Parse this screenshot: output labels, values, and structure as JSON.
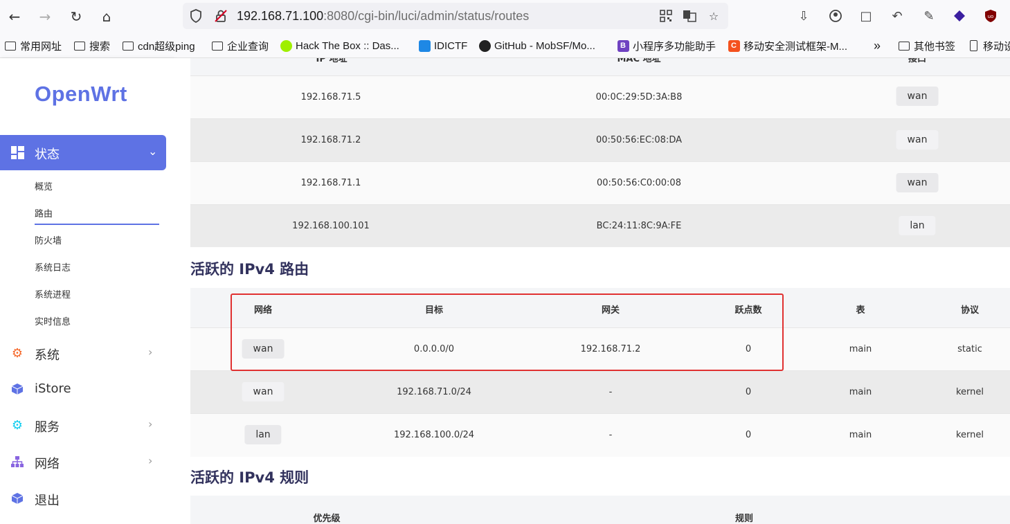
{
  "browser": {
    "url_host": "192.168.71.100",
    "url_rest": ":8080/cgi-bin/luci/admin/status/routes",
    "bookmarks": [
      {
        "label": "常用网址",
        "type": "folder"
      },
      {
        "label": "搜索",
        "type": "folder"
      },
      {
        "label": "cdn超级ping",
        "type": "folder"
      },
      {
        "label": "企业查询",
        "type": "folder"
      },
      {
        "label": "Hack The Box :: Das...",
        "type": "site"
      },
      {
        "label": "IDICTF",
        "type": "site"
      },
      {
        "label": "GitHub - MobSF/Mo...",
        "type": "site"
      },
      {
        "label": "小程序多功能助手",
        "type": "site"
      },
      {
        "label": "移动安全测试框架-M...",
        "type": "site"
      },
      {
        "label": "其他书签",
        "type": "folder"
      },
      {
        "label": "移动设",
        "type": "site"
      }
    ]
  },
  "sidebar": {
    "logo": "OpenWrt",
    "active_menu": "状态",
    "sub_items": [
      "概览",
      "路由",
      "防火墙",
      "系统日志",
      "系统进程",
      "实时信息"
    ],
    "menu": [
      "系统",
      "iStore",
      "服务",
      "网络",
      "退出"
    ]
  },
  "arp_table": {
    "headers": [
      "IP 地址",
      "MAC 地址",
      "接口"
    ],
    "rows": [
      {
        "ip": "192.168.71.5",
        "mac": "00:0C:29:5D:3A:B8",
        "iface": "wan"
      },
      {
        "ip": "192.168.71.2",
        "mac": "00:50:56:EC:08:DA",
        "iface": "wan"
      },
      {
        "ip": "192.168.71.1",
        "mac": "00:50:56:C0:00:08",
        "iface": "wan"
      },
      {
        "ip": "192.168.100.101",
        "mac": "BC:24:11:8C:9A:FE",
        "iface": "lan"
      }
    ]
  },
  "routes": {
    "title": "活跃的 IPv4 路由",
    "headers": [
      "网络",
      "目标",
      "网关",
      "跃点数",
      "表",
      "协议"
    ],
    "rows": [
      {
        "net": "wan",
        "target": "0.0.0.0/0",
        "gateway": "192.168.71.2",
        "metric": "0",
        "table": "main",
        "proto": "static"
      },
      {
        "net": "wan",
        "target": "192.168.71.0/24",
        "gateway": "-",
        "metric": "0",
        "table": "main",
        "proto": "kernel"
      },
      {
        "net": "lan",
        "target": "192.168.100.0/24",
        "gateway": "-",
        "metric": "0",
        "table": "main",
        "proto": "kernel"
      }
    ]
  },
  "rules": {
    "title": "活跃的 IPv4 规则",
    "headers": [
      "优先级",
      "规则"
    ]
  },
  "colors": {
    "accent": "#5e72e4",
    "highlight": "#e03131"
  }
}
